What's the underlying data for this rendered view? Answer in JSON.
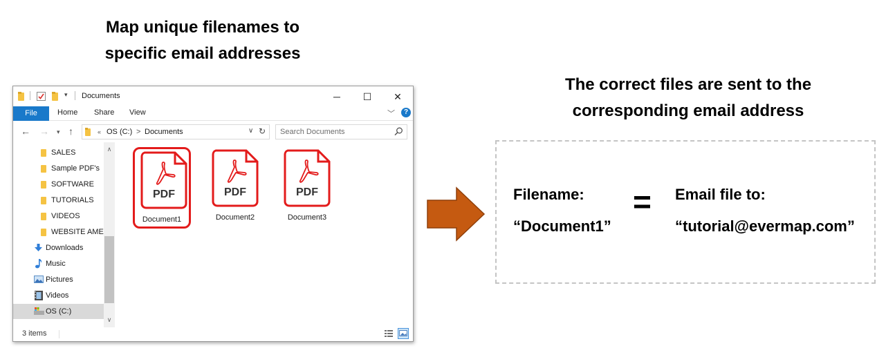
{
  "left_heading": [
    "Map unique filenames to",
    "specific email addresses"
  ],
  "right_heading": [
    "The correct files are sent to the",
    "corresponding email address"
  ],
  "explorer": {
    "window_title": "Documents",
    "ribbon_tabs": [
      "File",
      "Home",
      "Share",
      "View"
    ],
    "address_path": [
      "OS (C:)",
      "Documents"
    ],
    "address_overflow": "«",
    "address_separator": ">",
    "search_placeholder": "Search Documents",
    "sidebar": [
      {
        "label": "SALES",
        "icon": "folder-icon"
      },
      {
        "label": "Sample PDF's",
        "icon": "folder-icon"
      },
      {
        "label": "SOFTWARE",
        "icon": "folder-icon"
      },
      {
        "label": "TUTORIALS",
        "icon": "folder-icon"
      },
      {
        "label": "VIDEOS",
        "icon": "folder-icon"
      },
      {
        "label": "WEBSITE AMENDMENTS",
        "icon": "folder-icon"
      },
      {
        "label": "Downloads",
        "icon": "download-icon"
      },
      {
        "label": "Music",
        "icon": "music-icon"
      },
      {
        "label": "Pictures",
        "icon": "pictures-icon"
      },
      {
        "label": "Videos",
        "icon": "videos-icon"
      },
      {
        "label": "OS (C:)",
        "icon": "drive-icon",
        "selected": true
      }
    ],
    "files": [
      {
        "name": "Document1",
        "type": "PDF",
        "selected": true
      },
      {
        "name": "Document2",
        "type": "PDF",
        "selected": false
      },
      {
        "name": "Document3",
        "type": "PDF",
        "selected": false
      }
    ],
    "status": "3 items"
  },
  "mapping": {
    "filename_label": "Filename:",
    "filename_value": "“Document1”",
    "equals": "=",
    "email_label": "Email file to:",
    "email_value": "“tutorial@evermap.com”"
  },
  "colors": {
    "accent": "#1979ca",
    "pdf_red": "#e31b1b",
    "arrow_fill": "#c55a11",
    "folder": "#f5c343"
  }
}
